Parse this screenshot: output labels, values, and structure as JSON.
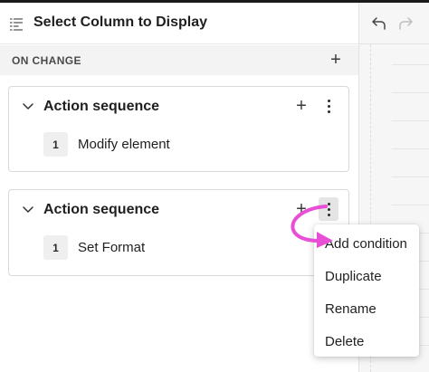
{
  "panel": {
    "title": "Select Column to Display",
    "section_label": "ON CHANGE",
    "section_add": "+"
  },
  "cards": [
    {
      "title": "Action sequence",
      "add": "+",
      "step_number": "1",
      "step_label": "Modify element"
    },
    {
      "title": "Action sequence",
      "add": "+",
      "step_number": "1",
      "step_label": "Set Format"
    }
  ],
  "menu": {
    "items": [
      "Add condition",
      "Duplicate",
      "Rename",
      "Delete"
    ]
  },
  "colors": {
    "annotation_arrow": "#e84fd6",
    "panel_bg": "#ffffff",
    "canvas_bg": "#f6f6f6"
  },
  "icons": {
    "header": "list-settings-icon",
    "collapse": "chevron-down-icon",
    "more": "more-vertical-icon",
    "undo": "undo-icon",
    "redo": "redo-icon"
  }
}
